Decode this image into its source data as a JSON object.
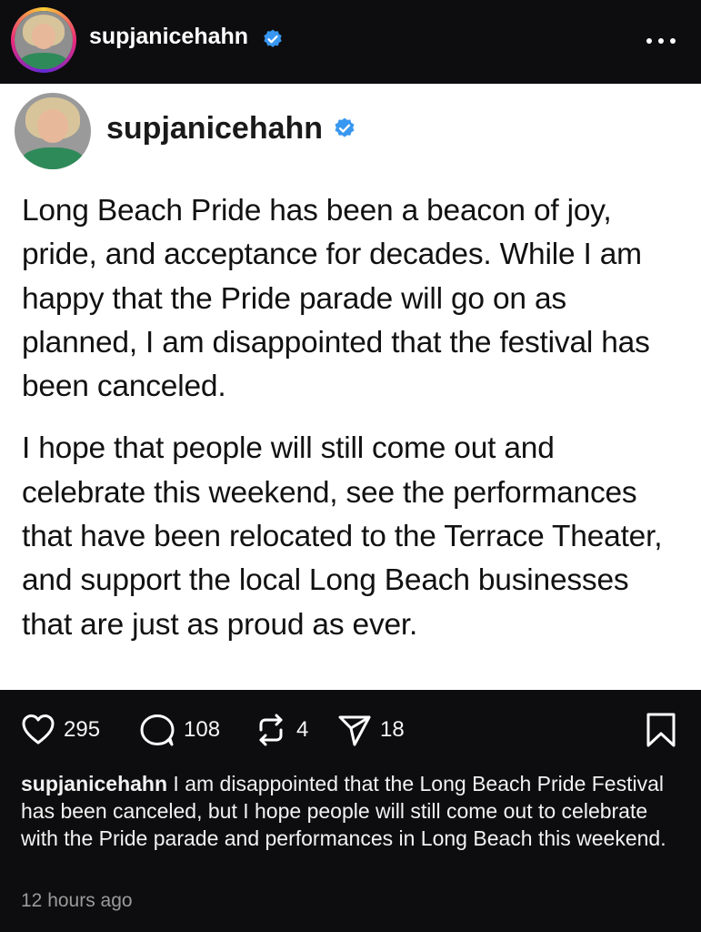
{
  "header": {
    "username": "supjanicehahn"
  },
  "post": {
    "username": "supjanicehahn",
    "paragraphs": [
      "Long Beach Pride has been a beacon of joy, pride, and acceptance for decades. While I am happy that the Pride parade will go on as planned, I am disappointed that the festival has been canceled.",
      "I hope that people will still come out and celebrate this weekend, see the performances that have been relocated to the Terrace Theater, and support the local Long Beach businesses that are just as proud as ever."
    ]
  },
  "actions": {
    "likes": "295",
    "comments": "108",
    "reposts": "4",
    "shares": "18"
  },
  "caption": {
    "username": "supjanicehahn",
    "text": " I am disappointed that the Long Beach Pride Festival has been canceled, but I hope people will still come out to celebrate with the Pride parade and performances in Long Beach this weekend."
  },
  "timestamp": "12 hours ago",
  "colors": {
    "background": "#0d0d0f",
    "card": "#ffffff",
    "verified": "#3897f0",
    "muted": "#9a9a9a"
  },
  "icons": {
    "verified": "verified-badge-icon",
    "more": "more-options-icon",
    "like": "heart-icon",
    "comment": "comment-bubble-icon",
    "repost": "repost-icon",
    "share": "paper-plane-icon",
    "save": "bookmark-icon"
  }
}
